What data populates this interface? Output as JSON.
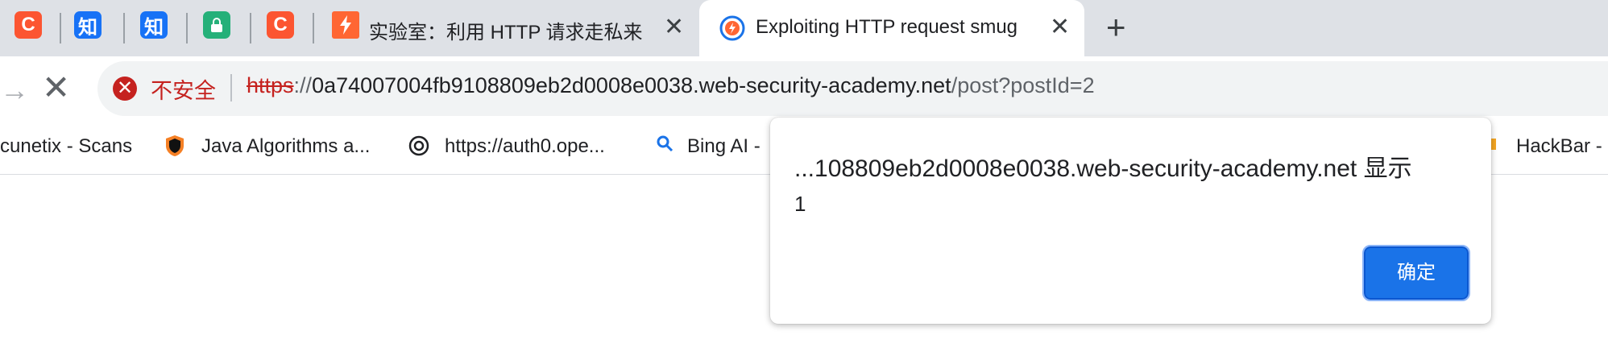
{
  "tabs": [
    {
      "icon": "C",
      "color": "#fc5531"
    },
    {
      "icon": "知",
      "color": "#1772f6"
    },
    {
      "icon": "知",
      "color": "#1772f6"
    },
    {
      "icon": "lock-icon",
      "color": "#25b079"
    },
    {
      "icon": "C",
      "color": "#fc5531"
    },
    {
      "title": "实验室：利用 HTTP 请求走私来",
      "icon": "lightning-icon",
      "color": "#ff6633"
    },
    {
      "title": "Exploiting HTTP request smug",
      "icon": "portswigger-icon",
      "color": "#ff6633",
      "active": true
    }
  ],
  "omnibox": {
    "security_label": "不安全",
    "scheme": "https",
    "separator": "://",
    "host": "0a74007004fb9108809eb2d0008e0038.web-security-academy.net",
    "path": "/post?postId=2"
  },
  "bookmarks": [
    {
      "label": "cunetix - Scans"
    },
    {
      "label": "Java Algorithms a..."
    },
    {
      "label": "https://auth0.ope..."
    },
    {
      "label": "Bing AI -"
    },
    {
      "label": "HackBar -"
    }
  ],
  "dialog": {
    "title": "...108809eb2d0008e0038.web-security-academy.net 显示",
    "message": "1",
    "ok_label": "确定"
  }
}
